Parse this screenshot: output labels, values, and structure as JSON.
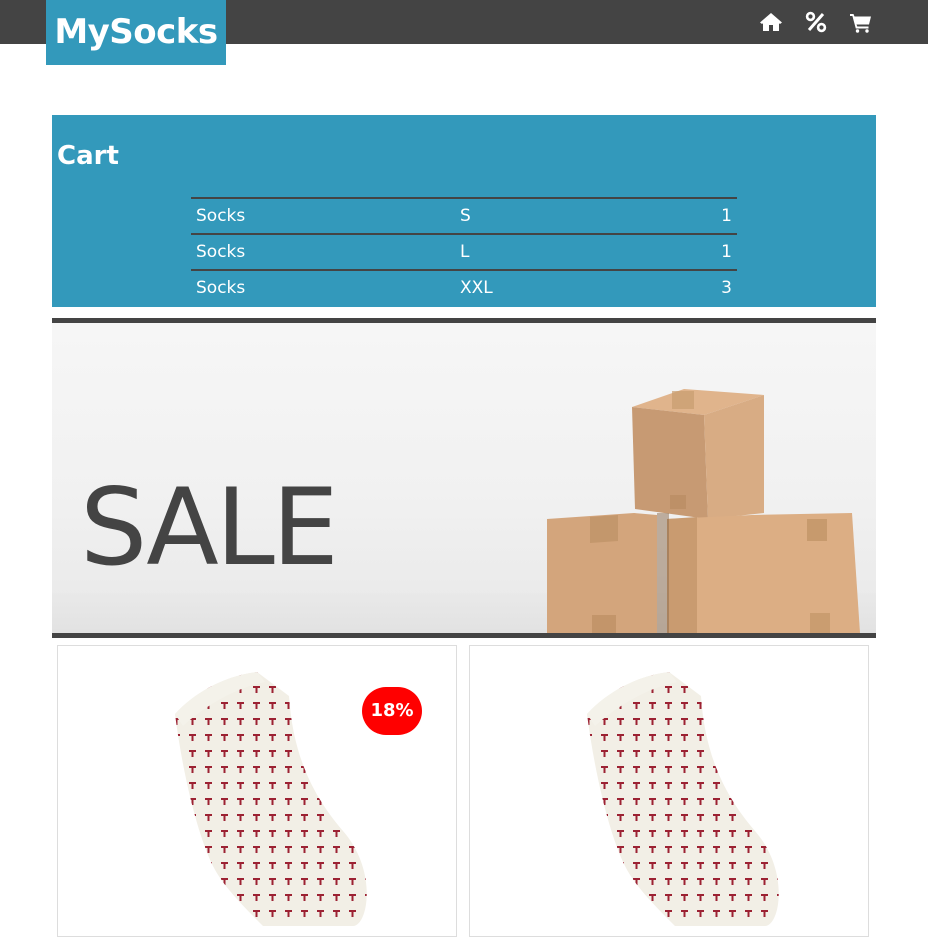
{
  "header": {
    "logo": "MySocks",
    "nav": [
      {
        "icon": "home-icon"
      },
      {
        "icon": "percent-icon"
      },
      {
        "icon": "cart-icon"
      }
    ]
  },
  "cart": {
    "title": "Cart",
    "rows": [
      {
        "name": "Socks",
        "size": "S",
        "qty": "1"
      },
      {
        "name": "Socks",
        "size": "L",
        "qty": "1"
      },
      {
        "name": "Socks",
        "size": "XXL",
        "qty": "3"
      }
    ]
  },
  "banner": {
    "text": "SALE"
  },
  "products": [
    {
      "discount": "18%"
    },
    {
      "discount": null
    }
  ],
  "colors": {
    "topbar": "#444444",
    "accent": "#3399bb",
    "badge": "#ff0000"
  }
}
